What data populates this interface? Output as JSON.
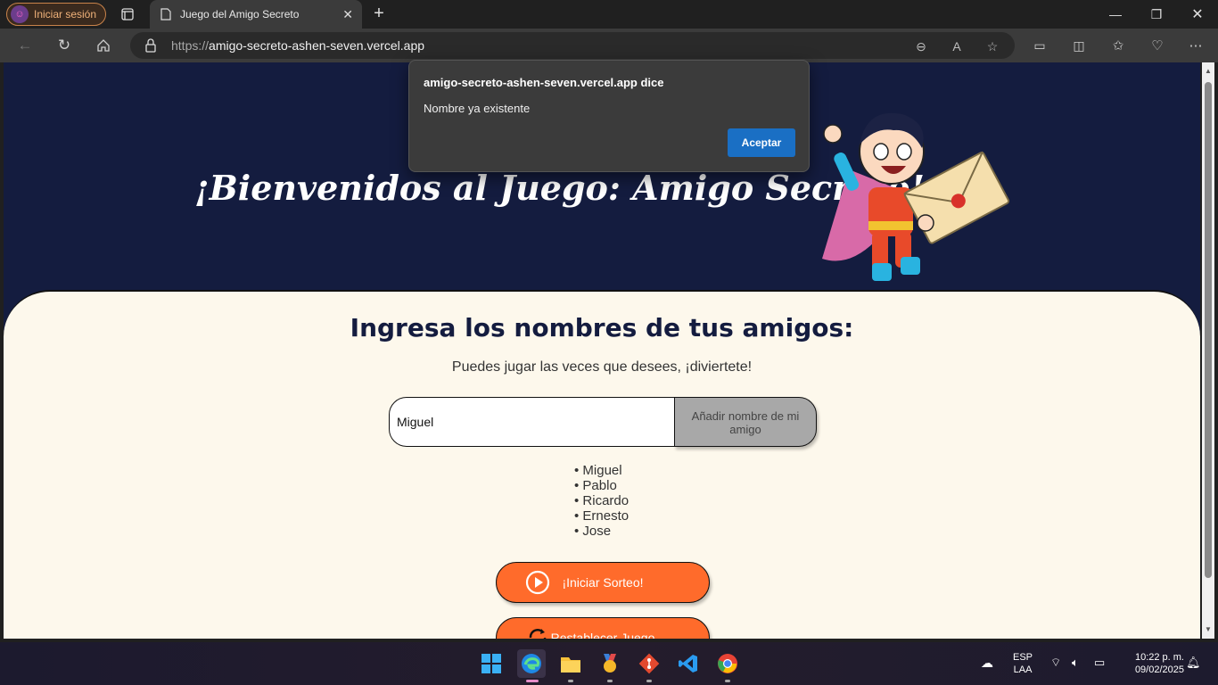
{
  "browser": {
    "profile_label": "Iniciar sesión",
    "tab_title": "Juego del Amigo Secreto",
    "url_prefix": "https://",
    "url_host": "amigo-secreto-ashen-seven.vercel.app"
  },
  "dialog": {
    "title": "amigo-secreto-ashen-seven.vercel.app dice",
    "message": "Nombre ya existente",
    "ok_label": "Aceptar"
  },
  "page": {
    "headline": "¡Bienvenidos al Juego: Amigo Secreto!",
    "card_title": "Ingresa los nombres de tus amigos:",
    "card_subtitle": "Puedes jugar las veces que desees, ¡diviertete!",
    "input_value": "Miguel",
    "add_button_label": "Añadir nombre de mi amigo",
    "friends": [
      "Miguel",
      "Pablo",
      "Ricardo",
      "Ernesto",
      "Jose"
    ],
    "draw_button_label": "¡Iniciar Sorteo!",
    "reset_button_label": "Restablecer Juego"
  },
  "taskbar": {
    "lang_top": "ESP",
    "lang_bottom": "LAA",
    "time": "10:22 p. m.",
    "date": "09/02/2025"
  },
  "colors": {
    "header_bg": "#141c3f",
    "card_bg": "#fdf8ec",
    "accent_orange": "#ff6b2b",
    "dialog_button": "#1a6fc4"
  }
}
